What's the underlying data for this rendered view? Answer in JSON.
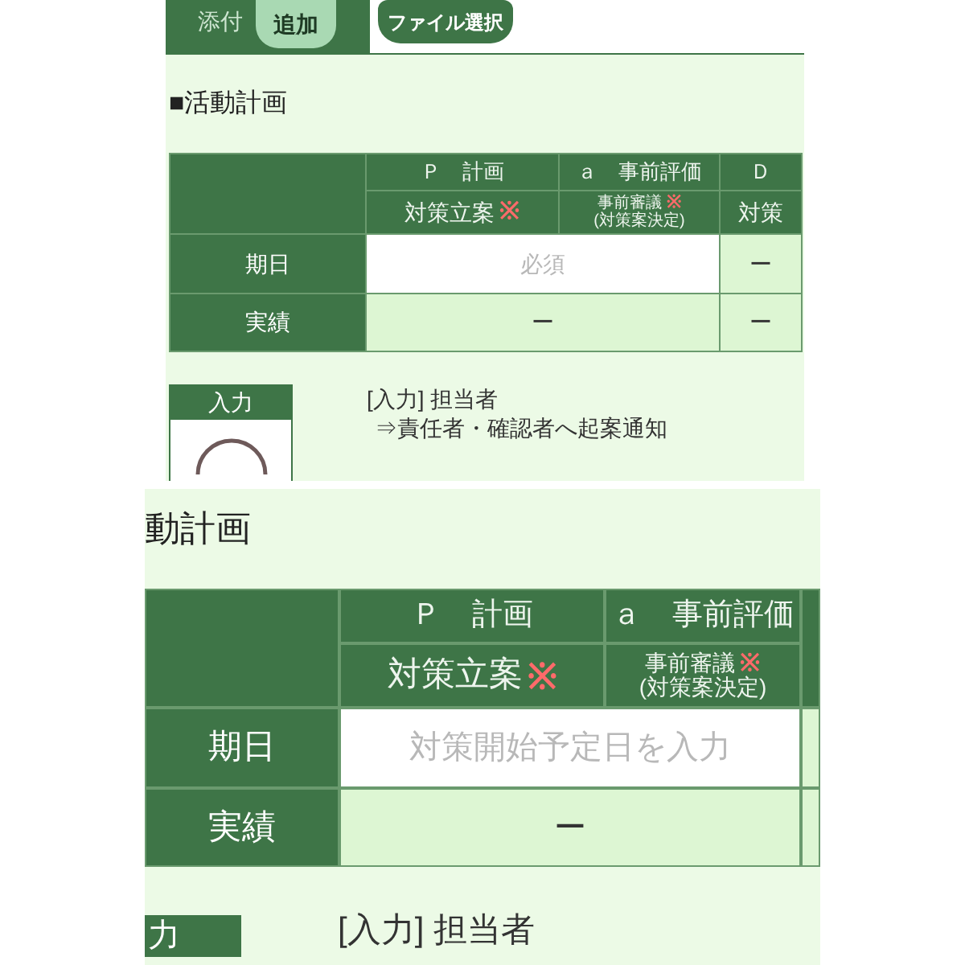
{
  "panels": [
    {
      "kind": "full",
      "attachment": {
        "label": "添付",
        "add_button": "追加",
        "file_button": "ファイル選択"
      },
      "section_title": "■活動計画",
      "table": {
        "columns": [
          {
            "phase": "Ｐ　計画",
            "task": "対策立案",
            "mark": "※"
          },
          {
            "phase": "ａ　事前評価",
            "task": "事前審議",
            "mark": "※",
            "note": "(対策案決定)"
          },
          {
            "phase": "Ｄ",
            "task": "対策"
          }
        ],
        "rows": [
          {
            "label": "期日",
            "cells": [
              {
                "kind": "input",
                "placeholder": "必須",
                "merged": true
              },
              {
                "kind": "text",
                "value": "ー",
                "merged": false
              }
            ]
          },
          {
            "label": "実績",
            "cells": [
              {
                "kind": "text",
                "value": "ー",
                "merged": true
              },
              {
                "kind": "text",
                "value": "ー",
                "merged": false
              }
            ]
          }
        ]
      },
      "step": {
        "label": "入力",
        "lines": [
          "[入力] 担当者",
          "⇒責任者・確認者へ起案通知"
        ]
      }
    },
    {
      "kind": "zoomed",
      "section_title": "動計画",
      "table": {
        "columns": [
          {
            "phase": "Ｐ　計画",
            "task": "対策立案",
            "mark": "※"
          },
          {
            "phase": "ａ　事前評価",
            "task": "事前審議",
            "mark": "※",
            "note": "(対策案決定)"
          }
        ],
        "rows": [
          {
            "label": "期日",
            "cells": [
              {
                "kind": "input",
                "placeholder": "対策開始予定日を入力",
                "merged": true
              }
            ]
          },
          {
            "label": "実績",
            "cells": [
              {
                "kind": "text",
                "value": "ー",
                "merged": true
              }
            ]
          }
        ]
      },
      "step": {
        "label": "力",
        "lines": [
          "[入力] 担当者"
        ]
      }
    }
  ]
}
